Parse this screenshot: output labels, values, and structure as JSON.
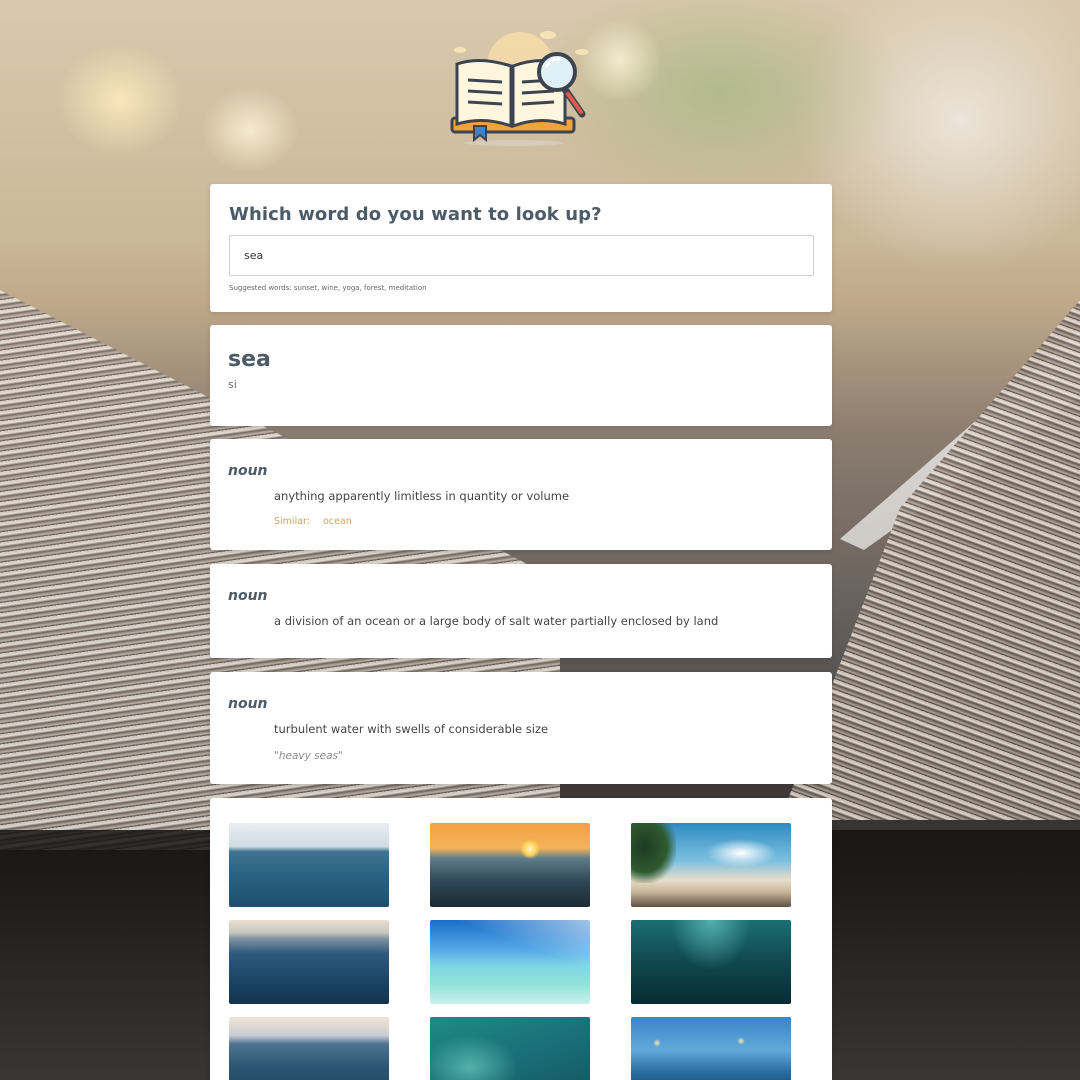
{
  "search": {
    "title": "Which word do you want to look up?",
    "value": "sea",
    "placeholder": "",
    "suggestions": "Suggested words: sunset, wine, yoga, forest, meditation"
  },
  "word": {
    "text": "sea",
    "phonetic": "si"
  },
  "meanings": [
    {
      "pos": "noun",
      "definition": "anything apparently limitless in quantity or volume",
      "similar_label": "Similar:",
      "similar_word": "ocean"
    },
    {
      "pos": "noun",
      "definition": "a division of an ocean or a large body of salt water partially enclosed by land"
    },
    {
      "pos": "noun",
      "definition": "turbulent water with swells of considerable size",
      "example": "\"heavy seas\""
    }
  ],
  "photos": [
    {
      "subject": "open-sea-horizon"
    },
    {
      "subject": "sunset-over-waves"
    },
    {
      "subject": "tropical-beach"
    },
    {
      "subject": "deep-blue-waves"
    },
    {
      "subject": "turquoise-shallow-sea"
    },
    {
      "subject": "underwater-light"
    },
    {
      "subject": "rolling-waves"
    },
    {
      "subject": "aerial-teal-water"
    },
    {
      "subject": "pier-at-dusk"
    }
  ],
  "colors": {
    "heading": "#4d5b66",
    "accent": "#c9a56a",
    "card": "#ffffff"
  }
}
